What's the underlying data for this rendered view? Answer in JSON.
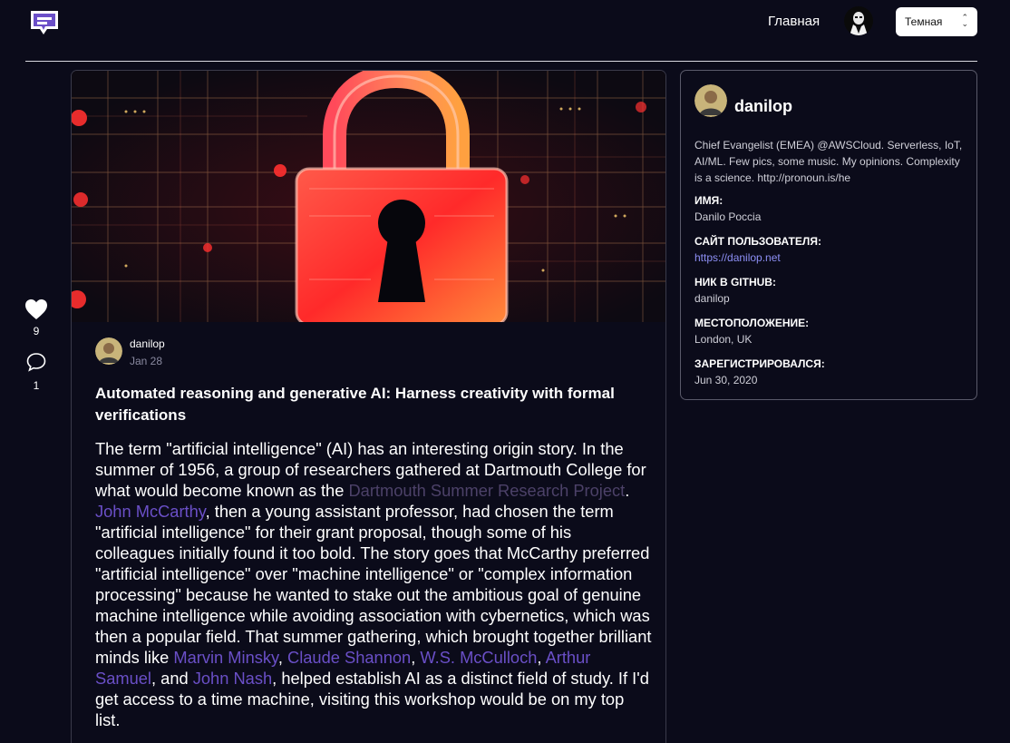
{
  "header": {
    "nav_home": "Главная",
    "theme_select_value": "Темная",
    "accent_color": "#6b4fc8"
  },
  "reactions": {
    "likes": "9",
    "comments": "1"
  },
  "article": {
    "author": "danilop",
    "date": "Jan 28",
    "title": "Automated reasoning and generative AI: Harness creativity with formal verifications",
    "body": {
      "p1": "The term \"artificial intelligence\" (AI) has an interesting origin story. In the summer of 1956, a group of researchers gathered at Dartmouth College for what would become known as the ",
      "link_dartmouth": "Dartmouth Summer Research Project",
      "p2": ". ",
      "link_mccarthy": "John McCarthy",
      "p3": ", then a young assistant professor, had chosen the term \"artificial intelligence\" for their grant proposal, though some of his colleagues initially found it too bold. The story goes that McCarthy preferred \"artificial intelligence\" over \"machine intelligence\" or \"complex information processing\" because he wanted to stake out the ambitious goal of genuine machine intelligence while avoiding association with cybernetics, which was then a popular field. That summer gathering, which brought together brilliant minds like ",
      "link_minsky": "Marvin Minsky",
      "sep1": ", ",
      "link_shannon": "Claude Shannon",
      "sep2": ", ",
      "link_mcculloch": "W.S. McCulloch",
      "sep3": ", ",
      "link_samuel": "Arthur Samuel",
      "p4": ", and ",
      "link_nash": "John Nash",
      "p5": ", helped establish AI as a distinct field of study. If I'd get access to a time machine, visiting this workshop would be on my top list."
    }
  },
  "profile": {
    "username": "danilop",
    "bio": "Chief Evangelist (EMEA) @AWSCloud. Serverless, IoT, AI/ML. Few pics, some music. My opinions. Complexity is a science. http://pronoun.is/he",
    "fields": [
      {
        "label": "ИМЯ:",
        "value": "Danilo Poccia"
      },
      {
        "label": "САЙТ ПОЛЬЗОВАТЕЛЯ:",
        "value": "https://danilop.net"
      },
      {
        "label": "НИК В GITHUB:",
        "value": "danilop"
      },
      {
        "label": "МЕСТОПОЛОЖЕНИЕ:",
        "value": "London, UK"
      },
      {
        "label": "ЗАРЕГИСТРИРОВАЛСЯ:",
        "value": "Jun 30, 2020"
      }
    ]
  }
}
